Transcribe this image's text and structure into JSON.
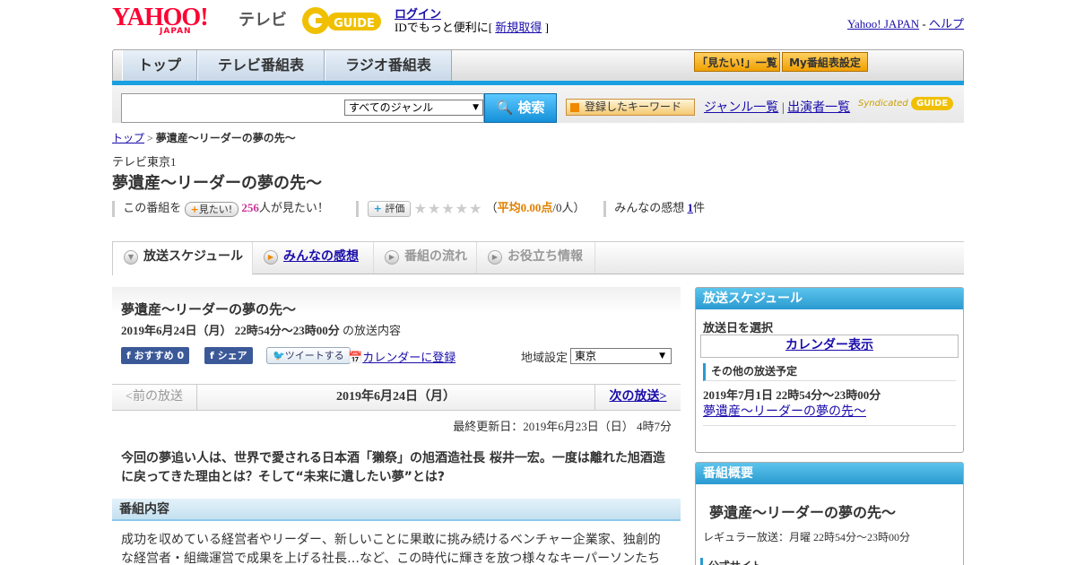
{
  "header": {
    "logo_text": "YAHOO!",
    "logo_sub": "JAPAN",
    "service": "テレビ",
    "guide_logo": "GUIDE",
    "login": "ログイン",
    "id_prefix": "IDでもっと便利に[",
    "register": "新規取得",
    "id_suffix": "]",
    "yahoo_japan": "Yahoo! JAPAN",
    "separator": "-",
    "help": "ヘルプ"
  },
  "nav": {
    "tabs": [
      "トップ",
      "テレビ番組表",
      "ラジオ番組表"
    ],
    "mitai_list": "「見たい!」一覧",
    "my_schedule": "My番組表設定"
  },
  "search": {
    "genre": "すべてのジャンル",
    "button": "検索",
    "keyword_button": "登録したキーワード",
    "genre_list": "ジャンル一覧",
    "divider": "|",
    "performer_list": "出演者一覧",
    "syndicated": "Syndicated"
  },
  "breadcrumb": {
    "top": "トップ",
    "sep": ">",
    "current": "夢遺産～リーダーの夢の先～"
  },
  "program": {
    "station": "テレビ東京1",
    "title": "夢遺産～リーダーの夢の先～",
    "this_program": "この番組を",
    "mitai_btn": "見たい!",
    "mitai_count": "256",
    "mitai_suffix": "人が見たい！",
    "rating_btn": "評価",
    "stars": "★★★★★",
    "avg_prefix": "（",
    "avg_label": "平均0.00点",
    "avg_suffix": "/0人）",
    "impressions_label": "みんなの感想",
    "impressions_count": "1",
    "impressions_suffix": "件"
  },
  "tabs": [
    {
      "label": "放送スケジュール",
      "active": true
    },
    {
      "label": "みんなの感想",
      "active": false
    },
    {
      "label": "番組の流れ",
      "active": false
    },
    {
      "label": "お役立ち情報",
      "active": false
    }
  ],
  "main": {
    "title": "夢遺産～リーダーの夢の先～",
    "date": "2019年6月24日（月）  22時54分～23時00分",
    "date_suffix": "の放送内容",
    "fb_recommend": "おすすめ 0",
    "fb_share": "シェア",
    "tweet": "ツイートする",
    "calendar_register": "カレンダーに登録",
    "region_label": "地域設定",
    "region_value": "東京",
    "prev": "<前の放送",
    "current_date": "2019年6月24日（月）",
    "next": "次の放送>",
    "updated": "最終更新日：2019年6月23日（日） 4時7分",
    "summary": "今回の夢追い人は、世界で愛される日本酒「獺祭」の旭酒造社長 桜井一宏。一度は離れた旭酒造に戻ってきた理由とは？そして“未来に遺したい夢”とは?",
    "section_title": "番組内容",
    "content": "成功を収めている経営者やリーダー、新しいことに果敢に挑み続けるベンチャー企業家、独創的な経営者・組織運営で成果を上げる社長…など、この時代に輝きを放つ様々なキーパーソンたち"
  },
  "sidebar": {
    "schedule_head": "放送スケジュール",
    "select_day": "放送日を選択",
    "calendar_btn": "カレンダー表示",
    "other_head": "その他の放送予定",
    "other_date": "2019年7月1日  22時54分～23時00分",
    "other_link": "夢遺産～リーダーの夢の先～",
    "summary_head": "番組概要",
    "summary_title": "夢遺産～リーダーの夢の先～",
    "regular": "レギュラー放送：月曜 22時54分～23時00分",
    "official": "公式サイト"
  },
  "colors": {
    "accent": "#1aa0e0",
    "yahoo_red": "#ff0033",
    "mitai_pink": "#cc3399",
    "avg_orange": "#e08000"
  }
}
